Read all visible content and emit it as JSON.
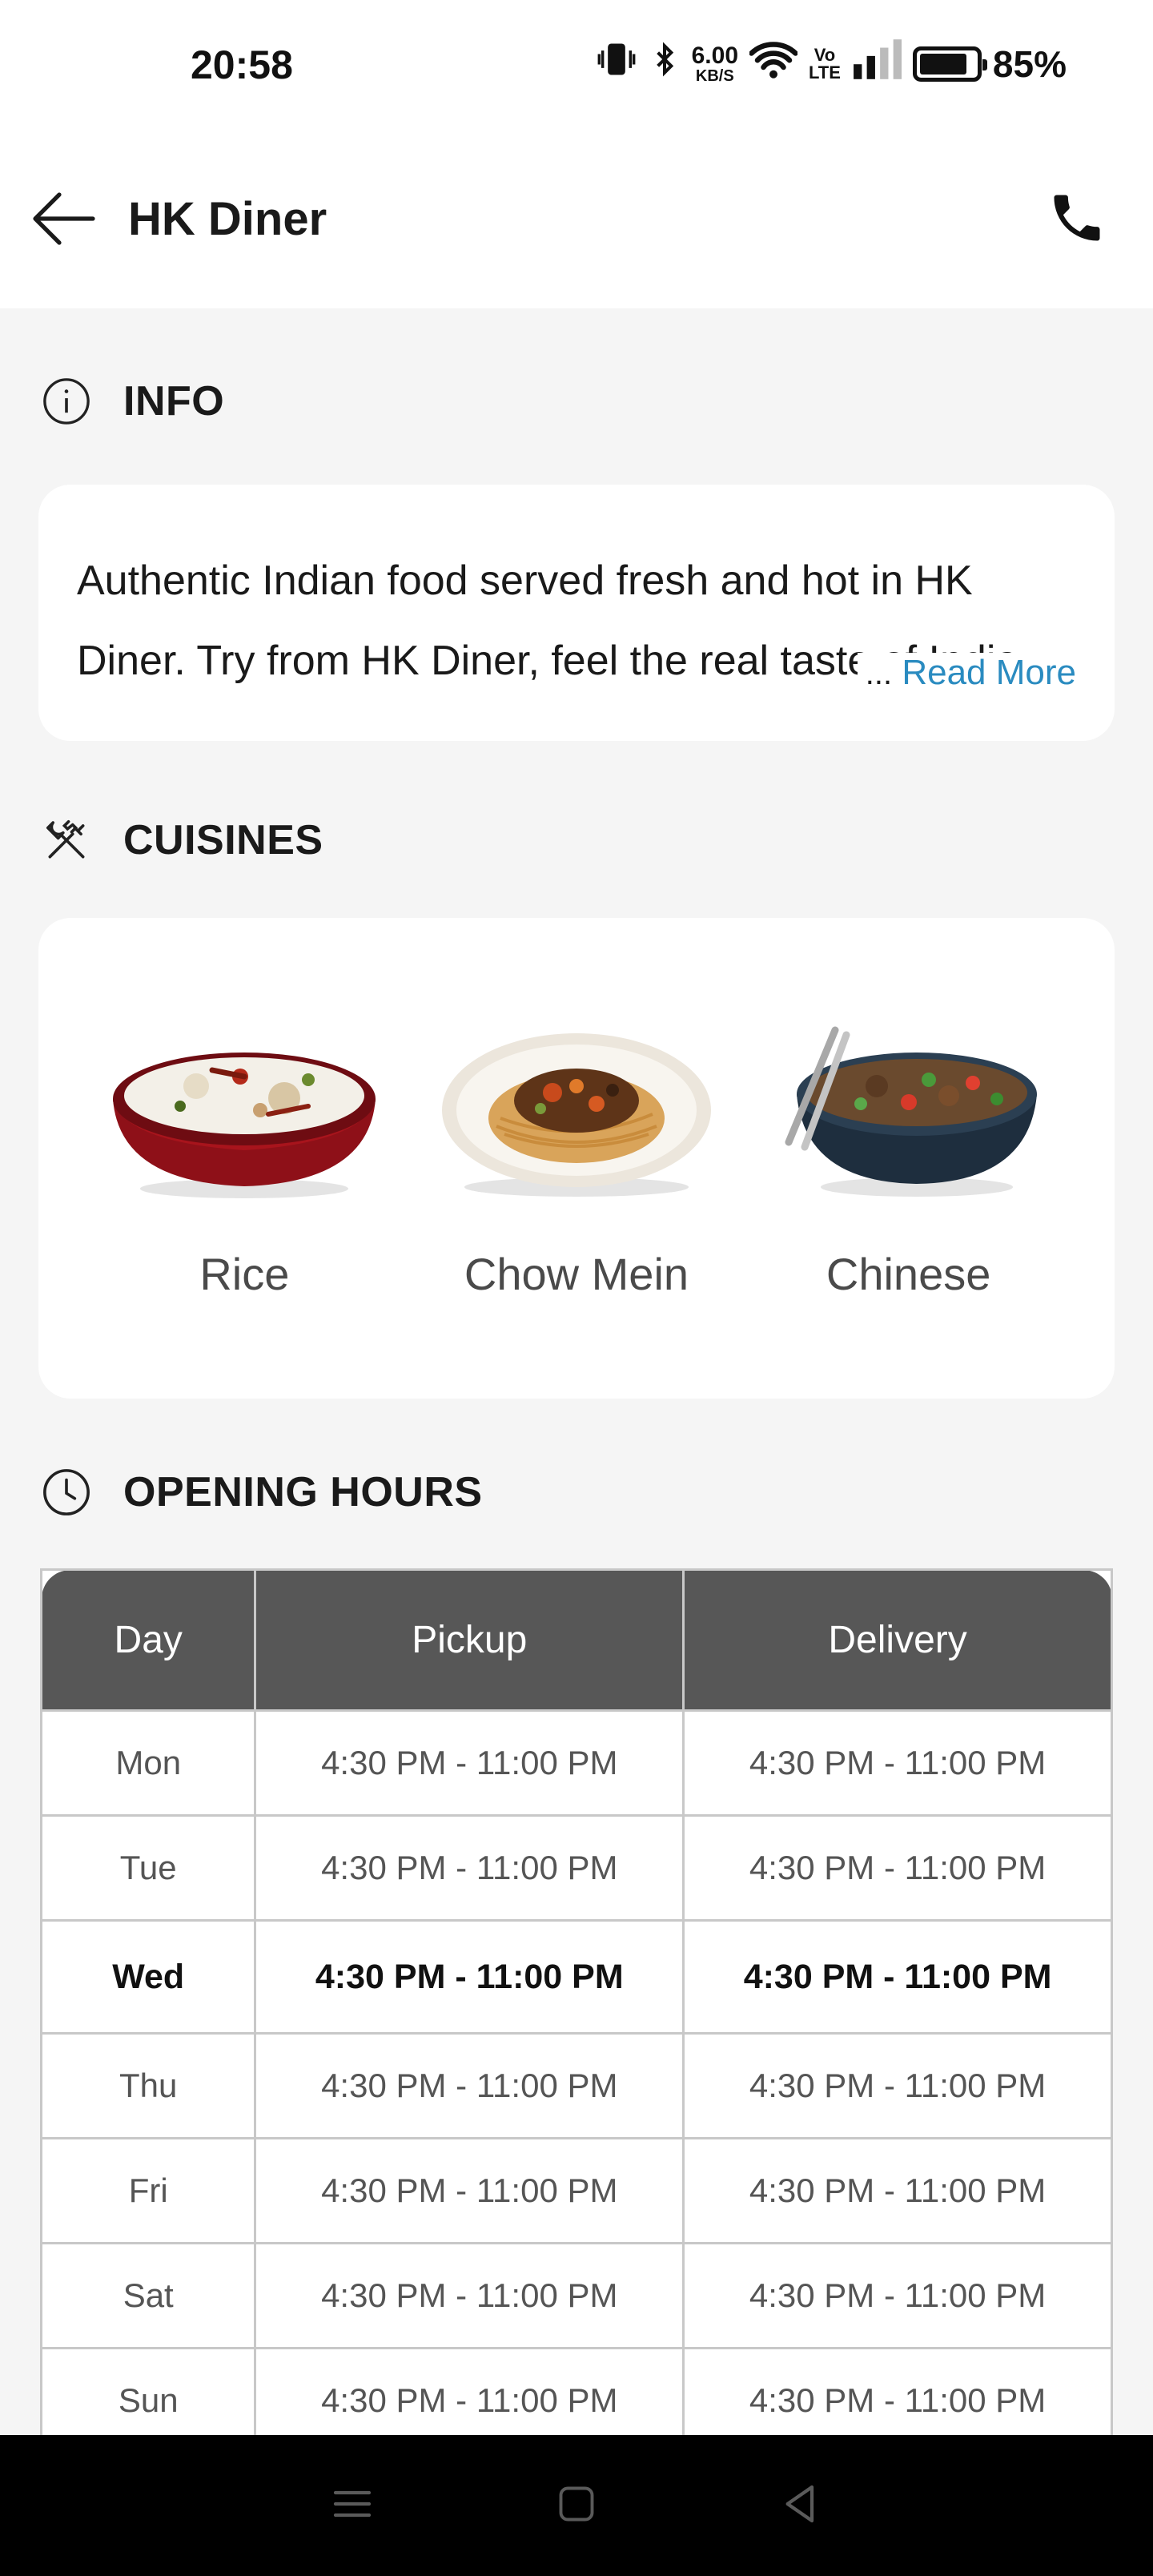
{
  "status_bar": {
    "time": "20:58",
    "net_speed": "6.00",
    "net_unit": "KB/S",
    "volte_top": "Vo",
    "volte_bottom": "LTE",
    "battery": "85%"
  },
  "header": {
    "title": "HK Diner",
    "back_icon": "arrow-left-icon",
    "call_icon": "phone-icon"
  },
  "info": {
    "section_title": "INFO",
    "icon": "info-circle-icon",
    "description": "Authentic Indian food served fresh and hot in HK Diner. Try from HK Diner, feel the real taste of India.",
    "ellipsis": "...",
    "read_more": "Read More"
  },
  "cuisines": {
    "section_title": "CUISINES",
    "icon": "cutlery-icon",
    "items": [
      {
        "label": "Rice",
        "image": "rice-bowl-image"
      },
      {
        "label": "Chow Mein",
        "image": "chow-mein-plate-image"
      },
      {
        "label": "Chinese",
        "image": "chinese-bowl-image"
      }
    ]
  },
  "opening_hours": {
    "section_title": "OPENING HOURS",
    "icon": "clock-icon",
    "columns": [
      "Day",
      "Pickup",
      "Delivery"
    ],
    "rows": [
      {
        "day": "Mon",
        "pickup": "4:30 PM - 11:00 PM",
        "delivery": "4:30 PM - 11:00 PM"
      },
      {
        "day": "Tue",
        "pickup": "4:30 PM - 11:00 PM",
        "delivery": "4:30 PM - 11:00 PM"
      },
      {
        "day": "Wed",
        "pickup": "4:30 PM - 11:00 PM",
        "delivery": "4:30 PM - 11:00 PM"
      },
      {
        "day": "Thu",
        "pickup": "4:30 PM - 11:00 PM",
        "delivery": "4:30 PM - 11:00 PM"
      },
      {
        "day": "Fri",
        "pickup": "4:30 PM - 11:00 PM",
        "delivery": "4:30 PM - 11:00 PM"
      },
      {
        "day": "Sat",
        "pickup": "4:30 PM - 11:00 PM",
        "delivery": "4:30 PM - 11:00 PM"
      },
      {
        "day": "Sun",
        "pickup": "4:30 PM - 11:00 PM",
        "delivery": "4:30 PM - 11:00 PM"
      }
    ],
    "highlighted_day": "Wed"
  },
  "nav_bar": {
    "menu_icon": "menu-lines-icon",
    "home_icon": "home-square-icon",
    "back_icon": "back-triangle-icon"
  },
  "colors": {
    "accent_link": "#2a8bc0",
    "table_header_bg": "#575757",
    "page_bg": "#f5f5f5"
  }
}
